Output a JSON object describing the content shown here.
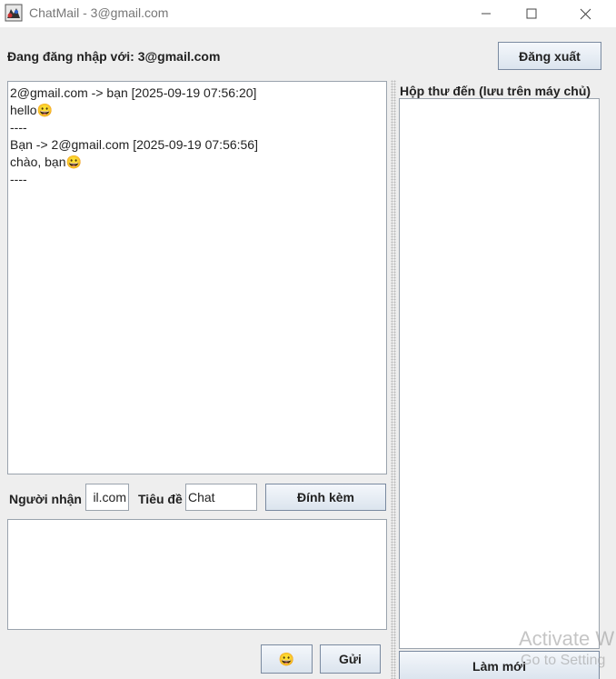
{
  "window": {
    "title": "ChatMail - 3@gmail.com",
    "controls": [
      "minimize-icon",
      "maximize-icon",
      "close-icon"
    ]
  },
  "header": {
    "login_label": "Đang đăng nhập với: 3@gmail.com",
    "logout_label": "Đăng xuất"
  },
  "chat_log": {
    "lines": [
      "2@gmail.com -> bạn [2025-09-19 07:56:20]",
      "hello😀",
      "----",
      "Bạn -> 2@gmail.com [2025-09-19 07:56:56]",
      "chào, bạn😀",
      "----"
    ]
  },
  "compose": {
    "recipient_label": "Người nhận",
    "recipient_value": "il.com",
    "subject_label": "Tiêu đề",
    "subject_value": "Chat",
    "attach_label": "Đính kèm",
    "message_value": "",
    "emoji_label": "😀",
    "send_label": "Gửi"
  },
  "inbox": {
    "title": "Hộp thư đến (lưu trên máy chủ)",
    "refresh_label": "Làm mới"
  },
  "watermark": {
    "line1": "Activate W",
    "line2": "Go to Setting"
  },
  "colors": {
    "button_border": "#7a8aa0",
    "field_border": "#9aa3ad",
    "background": "#eeeeee"
  }
}
